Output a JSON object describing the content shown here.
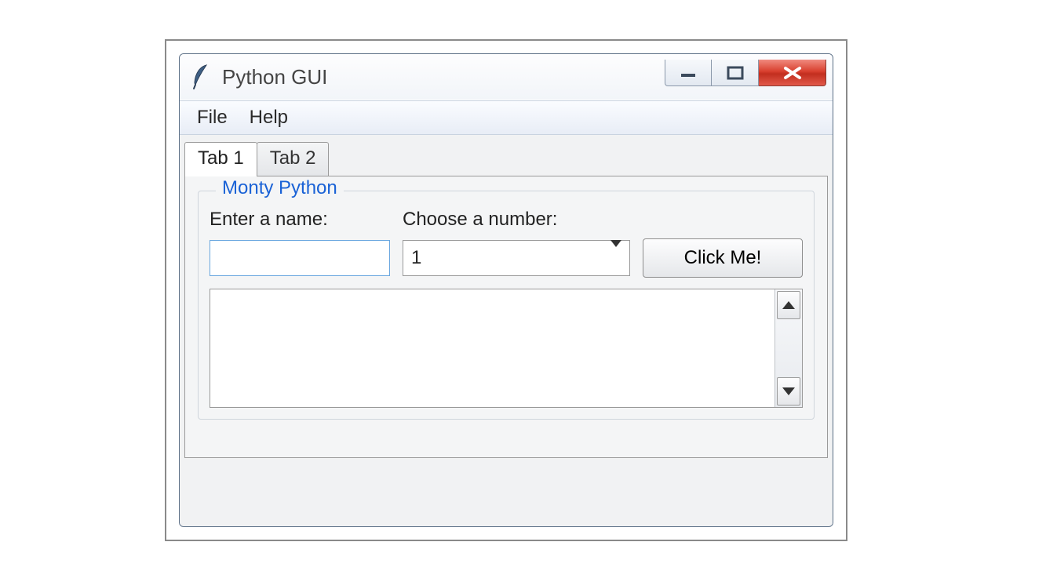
{
  "window": {
    "title": "Python GUI"
  },
  "menubar": {
    "items": [
      "File",
      "Help"
    ]
  },
  "tabs": {
    "items": [
      "Tab 1",
      "Tab 2"
    ],
    "active_index": 0
  },
  "group": {
    "legend": "Monty Python",
    "name_label": "Enter a name:",
    "number_label": "Choose a number:",
    "name_value": "",
    "number_value": "1",
    "button_label": "Click Me!"
  }
}
